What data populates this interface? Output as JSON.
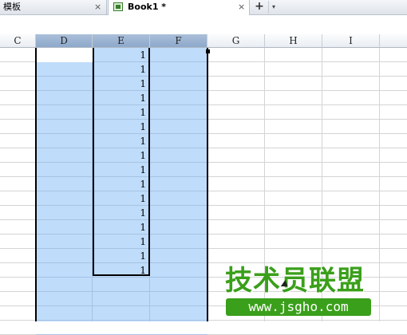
{
  "tabs": [
    {
      "label": "模板",
      "close": "×"
    },
    {
      "label": "Book1 *",
      "close": "×",
      "active": true
    }
  ],
  "new_tab": "+",
  "new_tab_menu": "▾",
  "columns": [
    "C",
    "D",
    "E",
    "F",
    "G",
    "H",
    "I"
  ],
  "selected_columns": [
    "D",
    "E",
    "F"
  ],
  "column_e_values": [
    "1",
    "1",
    "1",
    "1",
    "1",
    "1",
    "1",
    "1",
    "1",
    "1",
    "1",
    "1",
    "1",
    "1",
    "1",
    "1"
  ],
  "watermark": {
    "title": "技术员联盟",
    "url": "www.jsgho.com"
  },
  "colors": {
    "selection": "#bfdcfb",
    "header_selected": "#9db4d4",
    "watermark_green": "#3a9f1a"
  }
}
